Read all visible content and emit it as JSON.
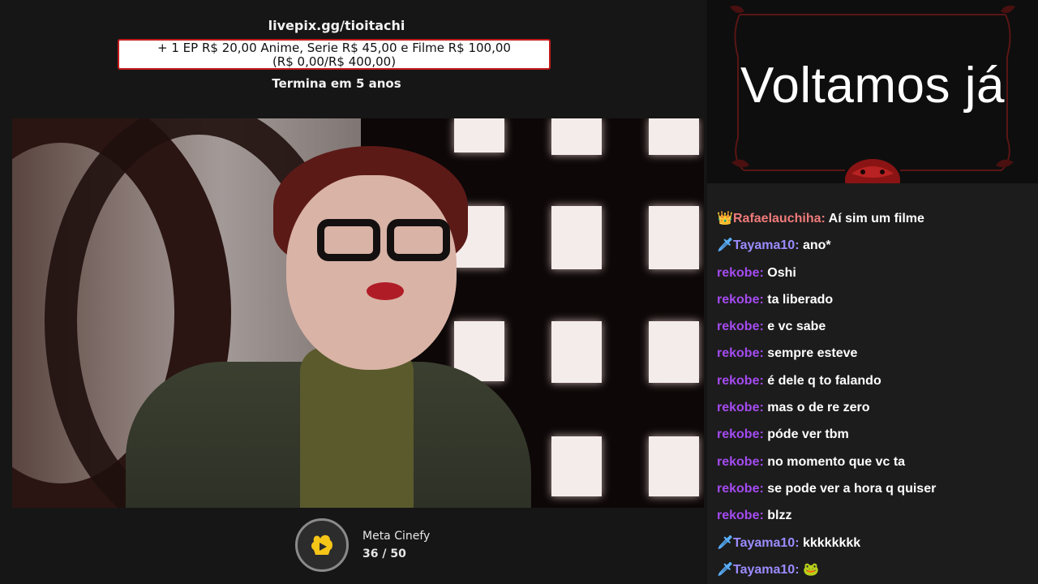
{
  "donation": {
    "url": "livepix.gg/tioitachi",
    "goal_line1": "+ 1 EP R$ 20,00 Anime, Serie R$ 45,00 e Filme R$ 100,00",
    "goal_line2": "(R$ 0,00/R$ 400,00)",
    "ends": "Termina em 5 anos"
  },
  "meta": {
    "title": "Meta Cinefy",
    "count": "36 / 50"
  },
  "banner": {
    "title": "Voltamos já"
  },
  "colors": {
    "accent_red": "#c21a1a",
    "rafael": "#f07a7a",
    "tayama": "#9a8cff",
    "rekobe": "#a44bf0"
  },
  "chat": [
    {
      "badge": "crown-icon",
      "badge_glyph": "👑",
      "user": "Rafaelauchiha",
      "color": "#f07a7a",
      "text": "Aí sim um filme"
    },
    {
      "badge": "sword-icon",
      "badge_glyph": "🗡",
      "user": "Tayama10",
      "color": "#9a8cff",
      "text": "ano*"
    },
    {
      "badge": "",
      "badge_glyph": "",
      "user": "rekobe",
      "color": "#a44bf0",
      "text": "Oshi"
    },
    {
      "badge": "",
      "badge_glyph": "",
      "user": "rekobe",
      "color": "#a44bf0",
      "text": "ta liberado"
    },
    {
      "badge": "",
      "badge_glyph": "",
      "user": "rekobe",
      "color": "#a44bf0",
      "text": "e vc sabe"
    },
    {
      "badge": "",
      "badge_glyph": "",
      "user": "rekobe",
      "color": "#a44bf0",
      "text": "sempre esteve"
    },
    {
      "badge": "",
      "badge_glyph": "",
      "user": "rekobe",
      "color": "#a44bf0",
      "text": "é dele q to falando"
    },
    {
      "badge": "",
      "badge_glyph": "",
      "user": "rekobe",
      "color": "#a44bf0",
      "text": "mas o de re zero"
    },
    {
      "badge": "",
      "badge_glyph": "",
      "user": "rekobe",
      "color": "#a44bf0",
      "text": "póde ver tbm"
    },
    {
      "badge": "",
      "badge_glyph": "",
      "user": "rekobe",
      "color": "#a44bf0",
      "text": "no momento que vc ta"
    },
    {
      "badge": "",
      "badge_glyph": "",
      "user": "rekobe",
      "color": "#a44bf0",
      "text": "se pode ver a hora q quiser"
    },
    {
      "badge": "",
      "badge_glyph": "",
      "user": "rekobe",
      "color": "#a44bf0",
      "text": "blzz"
    },
    {
      "badge": "sword-icon",
      "badge_glyph": "🗡",
      "user": "Tayama10",
      "color": "#9a8cff",
      "text": "kkkkkkkk"
    },
    {
      "badge": "sword-icon",
      "badge_glyph": "🗡",
      "user": "Tayama10",
      "color": "#9a8cff",
      "text": "🐸"
    }
  ]
}
